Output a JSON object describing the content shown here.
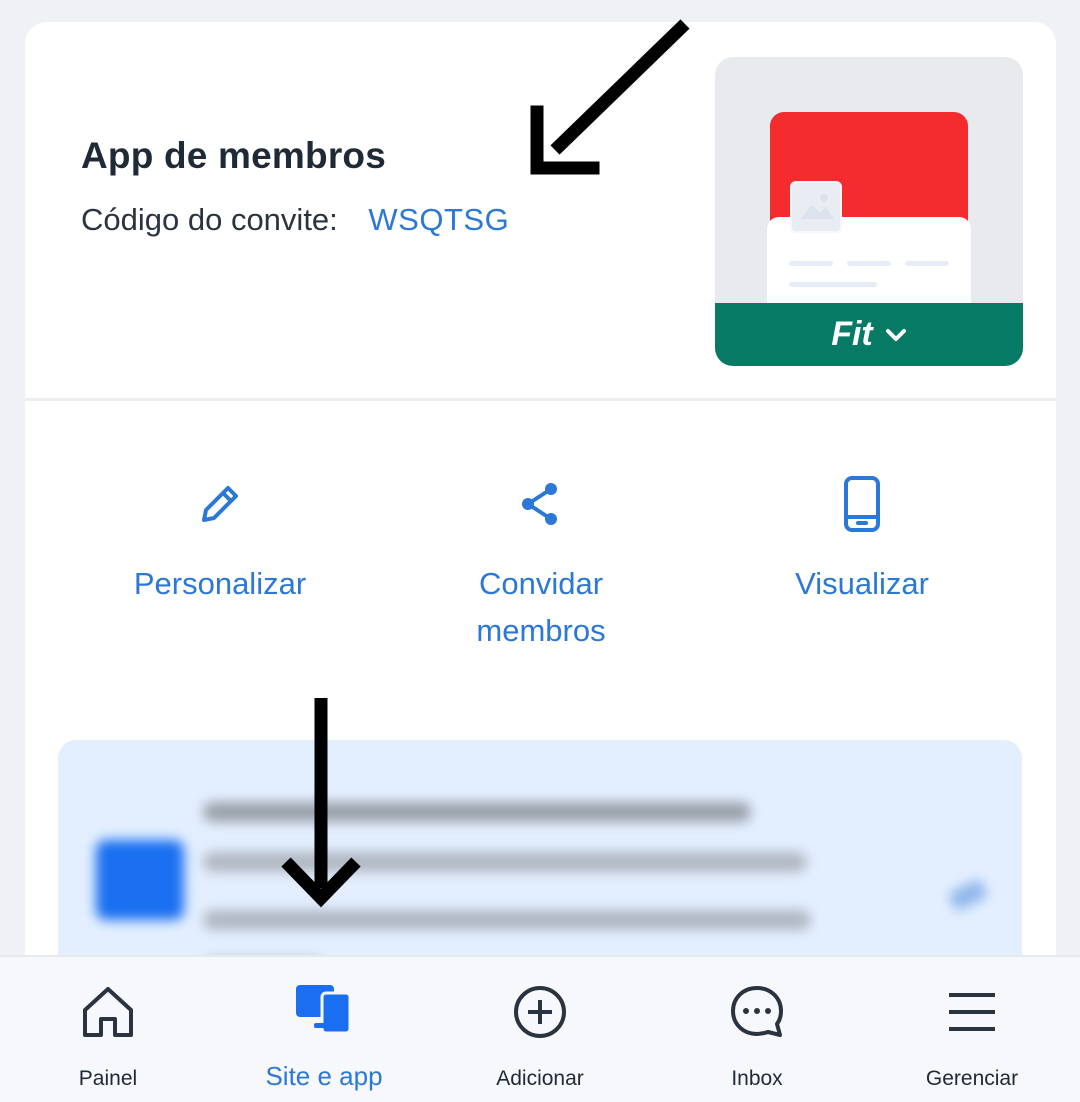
{
  "app": {
    "title": "App de membros",
    "invite_label": "Código do convite:",
    "invite_code": "WSQTSG"
  },
  "theme": {
    "name": "Fit",
    "accent": "#067a65",
    "header_color": "#f42c2d"
  },
  "actions": [
    {
      "label": "Personalizar",
      "icon": "pencil-icon"
    },
    {
      "label": "Convidar membros",
      "icon": "share-icon"
    },
    {
      "label": "Visualizar",
      "icon": "phone-icon"
    }
  ],
  "tabs": [
    {
      "label": "Painel",
      "icon": "home-icon",
      "active": false
    },
    {
      "label": "Site e app",
      "icon": "devices-icon",
      "active": true
    },
    {
      "label": "Adicionar",
      "icon": "plus-circle-icon",
      "active": false
    },
    {
      "label": "Inbox",
      "icon": "chat-icon",
      "active": false
    },
    {
      "label": "Gerenciar",
      "icon": "menu-icon",
      "active": false
    }
  ],
  "colors": {
    "link": "#2c78d6",
    "background": "#eff1f5"
  }
}
